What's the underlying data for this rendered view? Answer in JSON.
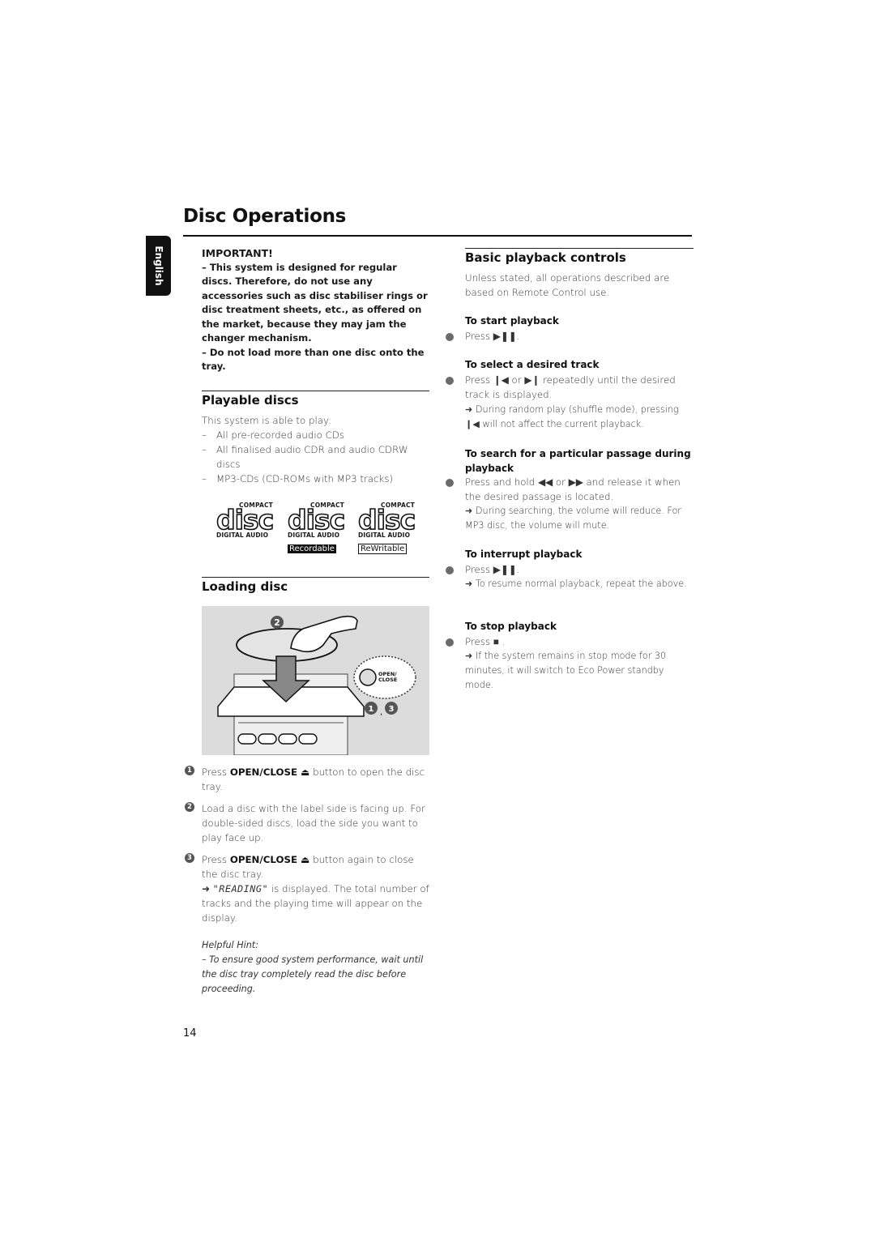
{
  "page": {
    "title": "Disc Operations",
    "language_tab": "English",
    "page_number": "14"
  },
  "important": {
    "heading": "IMPORTANT!",
    "items": [
      "–  This system is designed for regular discs. Therefore, do not use any accessories such as disc stabiliser rings or disc treatment sheets, etc., as offered on the market, because they may jam the changer mechanism.",
      "–  Do not load more than one disc onto the tray."
    ]
  },
  "playable_discs": {
    "heading": "Playable discs",
    "intro": "This system is able to play:",
    "items": [
      "All pre-recorded audio CDs",
      "All finalised audio CDR and audio CDRW discs",
      "MP3-CDs (CD-ROMs with MP3 tracks)"
    ],
    "logos": [
      {
        "top": "COMPACT",
        "main": "disc",
        "bottom": "DIGITAL AUDIO",
        "tag": ""
      },
      {
        "top": "COMPACT",
        "main": "disc",
        "bottom": "DIGITAL AUDIO",
        "tag": "Recordable"
      },
      {
        "top": "COMPACT",
        "main": "disc",
        "bottom": "DIGITAL AUDIO",
        "tag": "ReWritable"
      }
    ]
  },
  "loading_disc": {
    "heading": "Loading disc",
    "illustration": {
      "step_top": "2",
      "step_bottom": "1, 3",
      "button_label": "OPEN/ CLOSE"
    },
    "steps": [
      {
        "num": "1",
        "pre": "Press ",
        "bold": "OPEN/CLOSE ⏏",
        "post": " button to open the disc tray.",
        "note_lcd": "",
        "note": ""
      },
      {
        "num": "2",
        "pre": "Load a disc with the label side is facing up. For double-sided discs, load the side you want to play face up.",
        "bold": "",
        "post": "",
        "note_lcd": "",
        "note": ""
      },
      {
        "num": "3",
        "pre": "Press ",
        "bold": "OPEN/CLOSE ⏏",
        "post": " button again to close the disc tray.",
        "note_lcd": "\"READING\"",
        "note": " is displayed. The total number of tracks and the playing time will appear on the display."
      }
    ],
    "hint_title": "Helpful Hint:",
    "hint_text": "–  To ensure good system performance, wait until the disc tray completely read the disc before proceeding."
  },
  "basic_playback": {
    "heading": "Basic playback controls",
    "intro": "Unless stated, all operations described are based on Remote Control use.",
    "sections": [
      {
        "title": "To start playback",
        "action": "Press ▶❚❚.",
        "note": ""
      },
      {
        "title": "To select a desired track",
        "action": "Press ❙◀ or ▶❙ repeatedly until the desired track is displayed.",
        "note": "➜ During random play (shuffle mode), pressing ❙◀ will not affect the current playback."
      },
      {
        "title": "To search for a particular passage during playback",
        "action": "Press and hold ◀◀ or ▶▶ and release it when the desired passage is located.",
        "note": "➜ During searching, the volume will reduce. For MP3 disc, the volume will mute."
      },
      {
        "title": "To interrupt playback",
        "action": "Press ▶❚❚.",
        "note": "➜ To resume normal playback, repeat the above."
      },
      {
        "title": "To stop playback",
        "action": "Press ■ .",
        "note": "➜ If the system remains in stop mode for 30 minutes, it will switch to Eco Power standby mode."
      }
    ]
  }
}
